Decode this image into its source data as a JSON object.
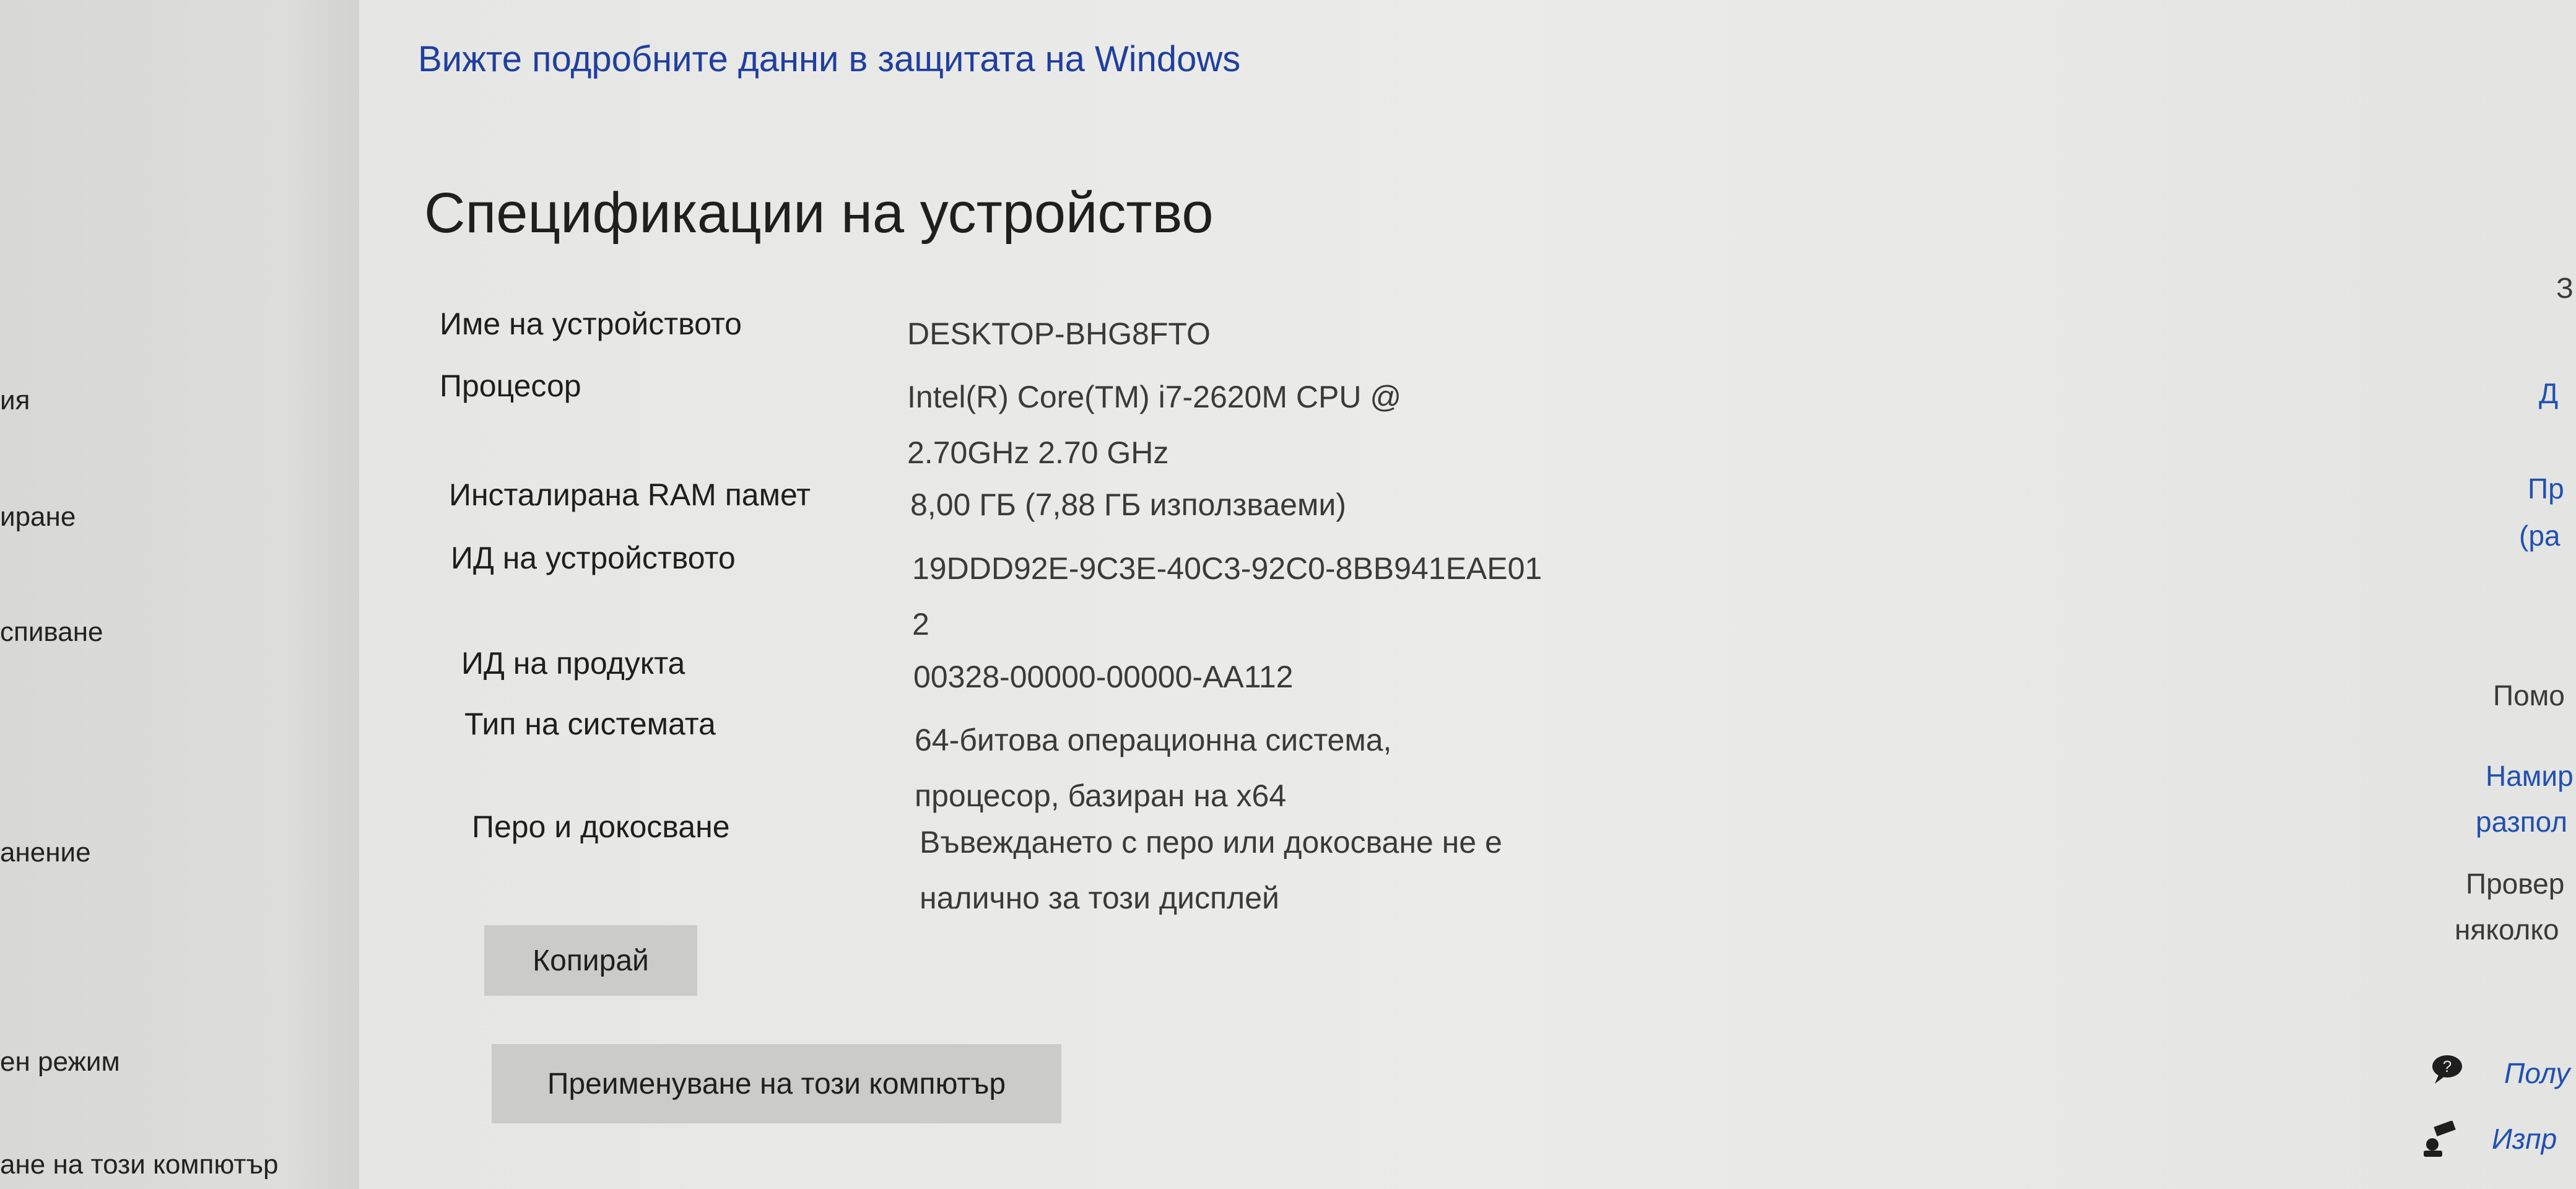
{
  "sidebar": {
    "items": [
      {
        "label": "ия"
      },
      {
        "label": "иране"
      },
      {
        "label": "спиване"
      },
      {
        "label": "анение"
      },
      {
        "label": "ен режим"
      },
      {
        "label": "ане на този компютър"
      }
    ]
  },
  "header": {
    "security_link": "Вижте подробните данни в защитата на Windows"
  },
  "specs": {
    "title": "Спецификации на устройство",
    "rows": [
      {
        "label": "Име на устройството",
        "value_lines": [
          "DESKTOP-BHG8FTO"
        ]
      },
      {
        "label": "Процесор",
        "value_lines": [
          "Intel(R) Core(TM) i7-2620M CPU @",
          "2.70GHz   2.70 GHz"
        ]
      },
      {
        "label": "Инсталирана RAM памет",
        "value_lines": [
          "8,00 ГБ (7,88 ГБ използваеми)"
        ]
      },
      {
        "label": "ИД на устройството",
        "value_lines": [
          "19DDD92E-9C3E-40C3-92C0-8BB941EAE01",
          "2"
        ]
      },
      {
        "label": "ИД на продукта",
        "value_lines": [
          "00328-00000-00000-AA112"
        ]
      },
      {
        "label": "Тип на системата",
        "value_lines": [
          "64-битова операционна система,",
          "процесор, базиран на x64"
        ]
      },
      {
        "label": "Перо и докосване",
        "value_lines": [
          "Въвеждането с перо или докосване не е",
          "налично за този дисплей"
        ]
      }
    ],
    "copy_button": "Копирай",
    "rename_button": "Преименуване на този компютър"
  },
  "right_panel": {
    "items": [
      {
        "text": "З"
      },
      {
        "text": "Д"
      },
      {
        "text": "Пр"
      },
      {
        "text": "(ра"
      },
      {
        "text": "Помо"
      },
      {
        "text": "Намир"
      },
      {
        "text": "разпол"
      },
      {
        "text": "Провер"
      },
      {
        "text": "няколко"
      },
      {
        "text": "Полу"
      },
      {
        "text": "Изпр"
      }
    ]
  },
  "icons": {
    "help": "help-chat-icon",
    "feedback": "feedback-icon"
  }
}
